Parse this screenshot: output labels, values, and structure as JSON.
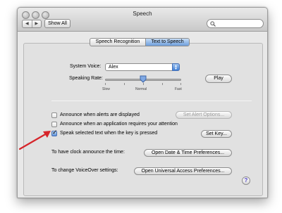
{
  "window": {
    "title": "Speech"
  },
  "toolbar": {
    "back_glyph": "◀",
    "forward_glyph": "▶",
    "show_all_label": "Show All",
    "search_value": ""
  },
  "tabs": [
    {
      "label": "Speech Recognition",
      "selected": false
    },
    {
      "label": "Text to Speech",
      "selected": true
    }
  ],
  "system_voice": {
    "label": "System Voice:",
    "value": "Alex"
  },
  "speaking_rate": {
    "label": "Speaking Rate:",
    "level": 0.5,
    "ticks": [
      "Slow",
      "Normal",
      "Fast"
    ],
    "play_label": "Play"
  },
  "options": [
    {
      "label": "Announce when alerts are displayed",
      "checked": false,
      "button": "Set Alert Options...",
      "button_enabled": false
    },
    {
      "label": "Announce when an application requires your attention",
      "checked": false
    },
    {
      "label": "Speak selected text when the key is pressed",
      "checked": true,
      "button": "Set Key..."
    }
  ],
  "clock": {
    "label": "To have clock announce the time:",
    "button": "Open Date & Time Preferences..."
  },
  "voiceover": {
    "label": "To change VoiceOver settings:",
    "button": "Open Universal Access Preferences..."
  },
  "help_glyph": "?",
  "colors": {
    "selected_tab": "#6e9fdc",
    "arrow": "#d6252a",
    "help_glyph": "#4c3ec8"
  }
}
